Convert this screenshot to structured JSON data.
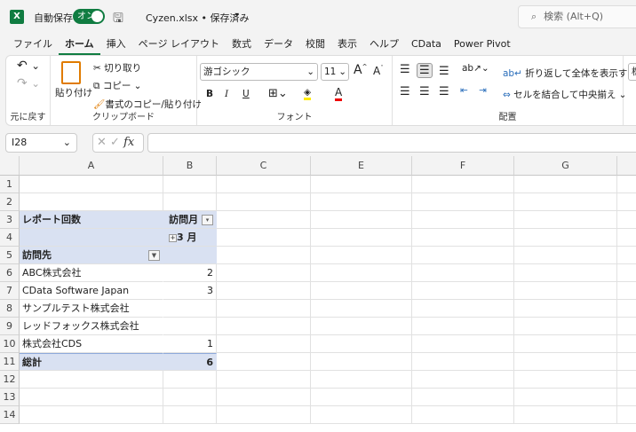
{
  "titlebar": {
    "autosave_label": "自動保存",
    "autosave_state": "オン",
    "filename": "Cyzen.xlsx • 保存済み",
    "search_placeholder": "検索 (Alt+Q)"
  },
  "tabs": [
    "ファイル",
    "ホーム",
    "挿入",
    "ページ レイアウト",
    "数式",
    "データ",
    "校閲",
    "表示",
    "ヘルプ",
    "CData",
    "Power Pivot"
  ],
  "ribbon": {
    "undo": {
      "label": "元に戻す"
    },
    "clipboard": {
      "label": "クリップボード",
      "paste": "貼り付け",
      "cut": "切り取り",
      "copy": "コピー",
      "format_painter": "書式のコピー/貼り付け"
    },
    "font": {
      "label": "フォント",
      "font_name": "游ゴシック",
      "font_size": "11",
      "bold": "B",
      "italic": "I",
      "underline": "U"
    },
    "alignment": {
      "label": "配置",
      "wrap_text": "折り返して全体を表示する",
      "merge_center": "セルを結合して中央揃え"
    },
    "number": {
      "format": "標"
    }
  },
  "formula_bar": {
    "name_box": "I28",
    "formula": ""
  },
  "columns": [
    "A",
    "B",
    "C",
    "E",
    "F",
    "G"
  ],
  "rows": [
    "1",
    "2",
    "3",
    "4",
    "5",
    "6",
    "7",
    "8",
    "9",
    "10",
    "11",
    "12",
    "13",
    "14"
  ],
  "pivot": {
    "value_label": "レポート回数",
    "column_field": "訪問月",
    "column_item": "3 月",
    "row_field": "訪問先",
    "items": [
      {
        "name": "ABC株式会社",
        "value": "2"
      },
      {
        "name": "CData Software Japan",
        "value": "3"
      },
      {
        "name": "サンプルテスト株式会社",
        "value": ""
      },
      {
        "name": "レッドフォックス株式会社",
        "value": ""
      },
      {
        "name": "株式会社CDS",
        "value": "1"
      }
    ],
    "total_label": "総計",
    "total_value": "6"
  }
}
